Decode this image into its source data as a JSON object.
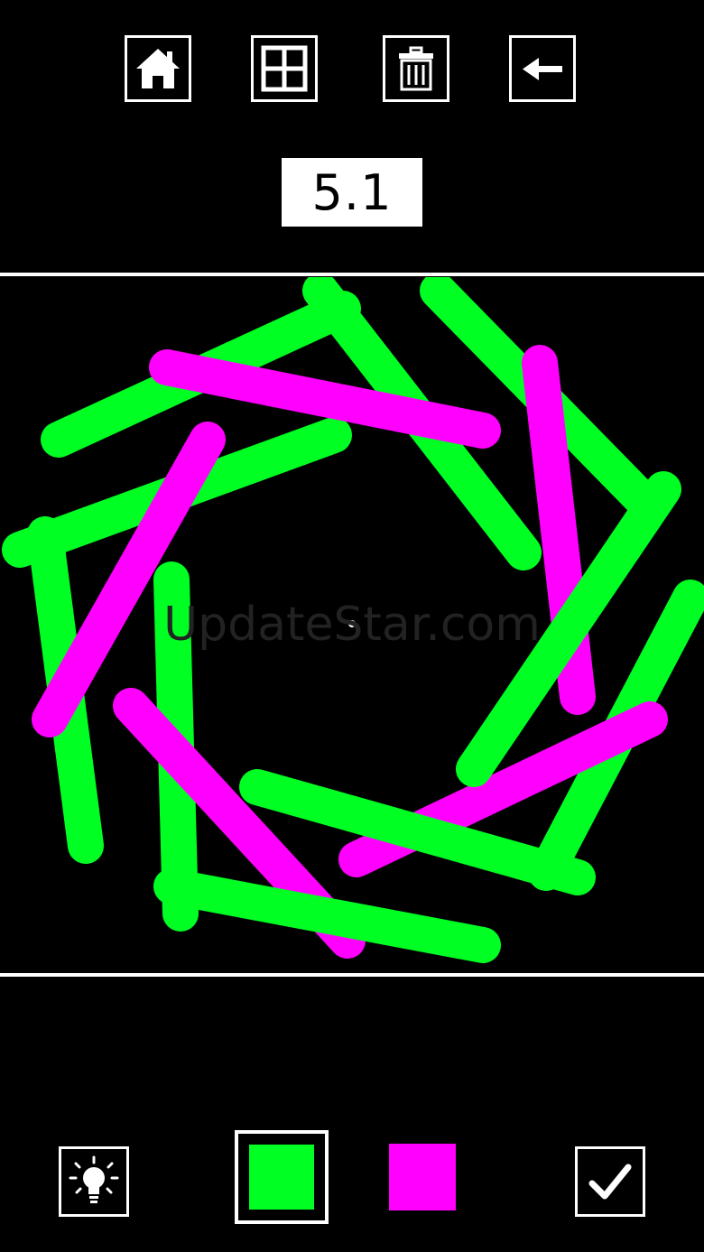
{
  "toolbar": {
    "home": "home-icon",
    "levels": "grid-icon",
    "delete": "trash-icon",
    "back": "arrow-left-icon"
  },
  "level": {
    "label": "5.1"
  },
  "watermark": {
    "text": "UpdateStar.com"
  },
  "colors": {
    "background": "#000000",
    "green": "#00ff22",
    "magenta": "#ff00ff",
    "frame": "#ffffff"
  },
  "palette": {
    "selected": "green",
    "options": [
      "green",
      "magenta"
    ]
  },
  "bottom": {
    "hint": "lightbulb-icon",
    "confirm": "checkmark-icon"
  }
}
